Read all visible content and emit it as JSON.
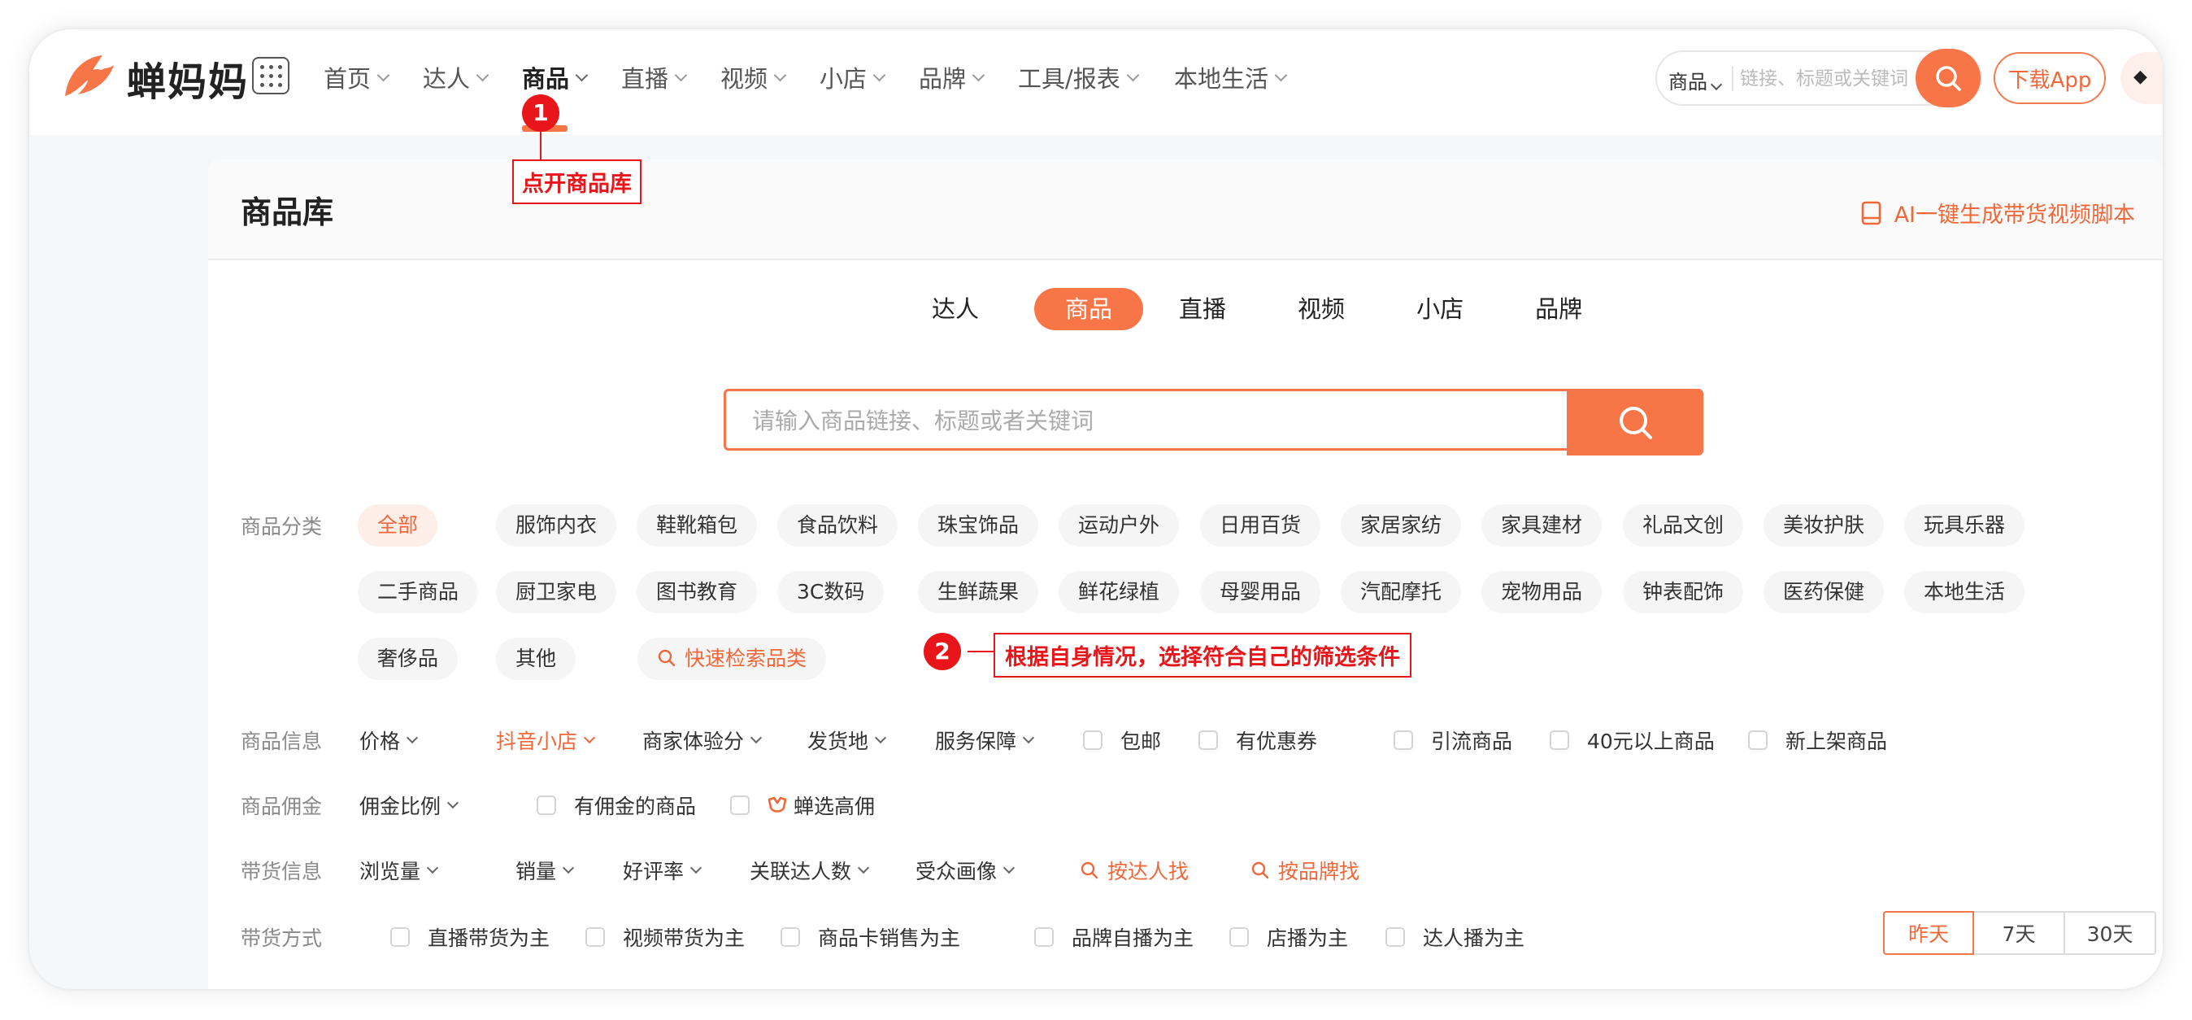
{
  "brand": {
    "name": "蝉妈妈",
    "accent": "#f87548"
  },
  "nav": [
    {
      "label": "首页"
    },
    {
      "label": "达人"
    },
    {
      "label": "商品",
      "active": true
    },
    {
      "label": "直播"
    },
    {
      "label": "视频"
    },
    {
      "label": "小店"
    },
    {
      "label": "品牌"
    },
    {
      "label": "工具/报表"
    },
    {
      "label": "本地生活"
    }
  ],
  "header_search": {
    "type_label": "商品",
    "placeholder": "链接、标题或关键词"
  },
  "download_label": "下载App",
  "page": {
    "title": "商品库",
    "ai_link": "AI一键生成带货视频脚本"
  },
  "tabs": [
    {
      "label": "达人"
    },
    {
      "label": "商品",
      "active": true
    },
    {
      "label": "直播"
    },
    {
      "label": "视频"
    },
    {
      "label": "小店"
    },
    {
      "label": "品牌"
    }
  ],
  "main_search": {
    "placeholder": "请输入商品链接、标题或者关键词"
  },
  "categories": {
    "label": "商品分类",
    "items": [
      "全部",
      "服饰内衣",
      "鞋靴箱包",
      "食品饮料",
      "珠宝饰品",
      "运动户外",
      "日用百货",
      "家居家纺",
      "家具建材",
      "礼品文创",
      "美妆护肤",
      "玩具乐器",
      "二手商品",
      "厨卫家电",
      "图书教育",
      "3C数码",
      "生鲜蔬果",
      "鲜花绿植",
      "母婴用品",
      "汽配摩托",
      "宠物用品",
      "钟表配饰",
      "医药保健",
      "本地生活",
      "奢侈品",
      "其他"
    ],
    "quick_search": "快速检索品类"
  },
  "product_info": {
    "label": "商品信息",
    "dropdowns": [
      "价格",
      "抖音小店",
      "商家体验分",
      "发货地",
      "服务保障"
    ],
    "checks": [
      "包邮",
      "有优惠券",
      "引流商品",
      "40元以上商品",
      "新上架商品"
    ]
  },
  "commission": {
    "label": "商品佣金",
    "dropdown": "佣金比例",
    "checks": [
      "有佣金的商品",
      "蝉选高佣"
    ]
  },
  "sales_info": {
    "label": "带货信息",
    "dropdowns": [
      "浏览量",
      "销量",
      "好评率",
      "关联达人数",
      "受众画像"
    ],
    "links": [
      "按达人找",
      "按品牌找"
    ]
  },
  "sales_mode": {
    "label": "带货方式",
    "checks": [
      "直播带货为主",
      "视频带货为主",
      "商品卡销售为主",
      "品牌自播为主",
      "店播为主",
      "达人播为主"
    ]
  },
  "time_range": {
    "options": [
      "昨天",
      "7天",
      "30天"
    ],
    "selected": "昨天"
  },
  "annotations": [
    {
      "number": "1",
      "text": "点开商品库"
    },
    {
      "number": "2",
      "text": "根据自身情况，选择符合自己的筛选条件"
    }
  ]
}
